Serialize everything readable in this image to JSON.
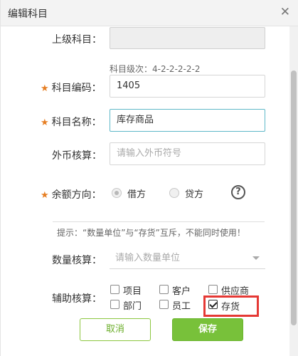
{
  "dialog": {
    "title": "编辑科目",
    "close_glyph": "✕"
  },
  "form": {
    "parent_subject": {
      "label": "上级科目：",
      "value": ""
    },
    "level_hint": "科目级次：4-2-2-2-2-2",
    "code": {
      "label": "科目编码：",
      "value": "1405"
    },
    "name": {
      "label": "科目名称：",
      "value": "库存商品"
    },
    "foreign_currency": {
      "label": "外币核算：",
      "placeholder": "请输入外币符号"
    },
    "balance_direction": {
      "label": "余额方向：",
      "options": [
        "借方",
        "贷方"
      ],
      "selected": "借方",
      "help_glyph": "?"
    },
    "tip": "提示：“数量单位”与“存货”互斥，不能同时使用！",
    "quantity": {
      "label": "数量核算：",
      "placeholder": "请输入数量单位"
    },
    "auxiliary": {
      "label": "辅助核算：",
      "options": [
        {
          "label": "项目",
          "checked": false
        },
        {
          "label": "客户",
          "checked": false
        },
        {
          "label": "供应商",
          "checked": false
        },
        {
          "label": "部门",
          "checked": false
        },
        {
          "label": "员工",
          "checked": false
        },
        {
          "label": "存货",
          "checked": true
        }
      ]
    }
  },
  "buttons": {
    "cancel": "取消",
    "save": "保存"
  },
  "colors": {
    "accent_green": "#78c13a",
    "star_orange": "#e67e22",
    "highlight_red": "#e53935",
    "focus_border": "#5eb8c8"
  }
}
